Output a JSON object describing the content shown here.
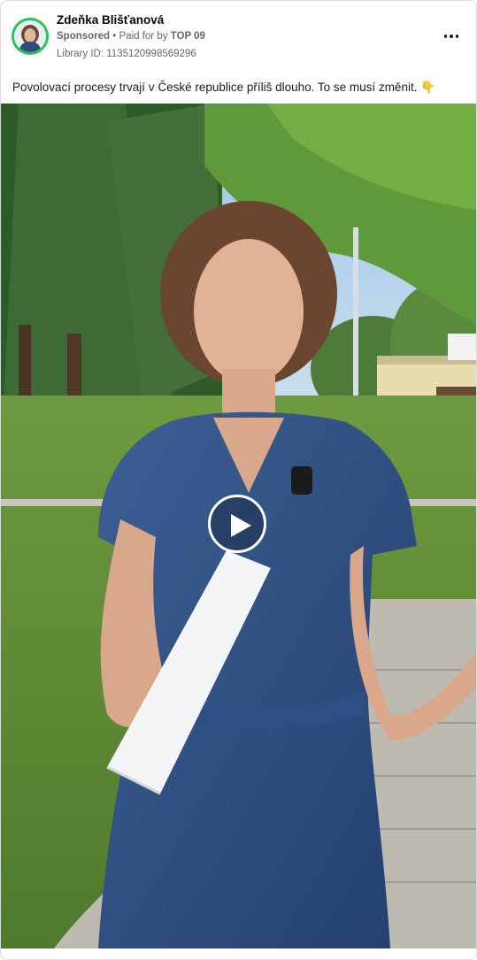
{
  "ad": {
    "advertiser_name": "Zdeňka Blišťanová",
    "sponsored_label": "Sponsored",
    "separator": "•",
    "paid_for_prefix": "Paid for by",
    "paid_for_by": "TOP 09",
    "library_id": "Library ID: 1135120998569296",
    "caption": "Povolovací procesy trvají v České republice příliš dlouho. To se musí změnit. 👇",
    "avatar_ring_color": "#22c55e"
  },
  "icons": {
    "more": "more-horizontal-icon",
    "play": "play-icon"
  }
}
